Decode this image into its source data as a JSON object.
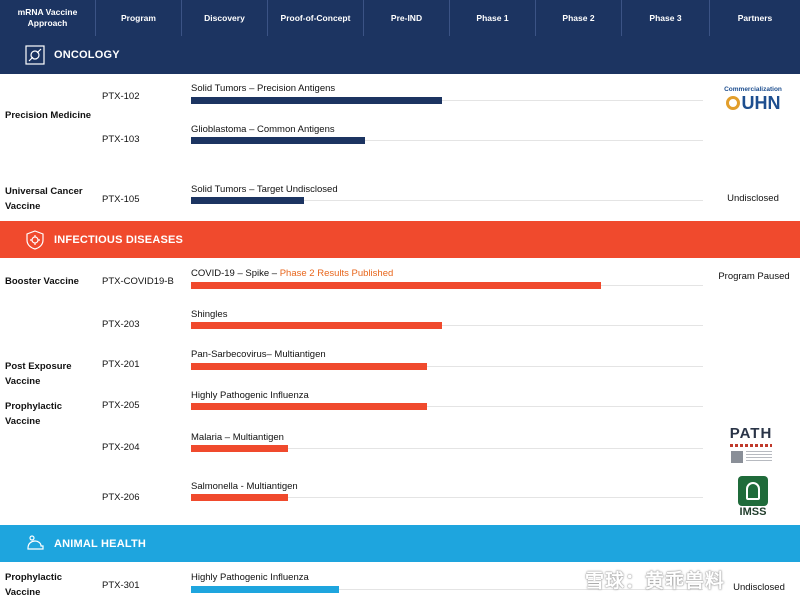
{
  "columns": {
    "approach": "mRNA Vaccine Approach",
    "program": "Program",
    "discovery": "Discovery",
    "poc": "Proof-of-Concept",
    "preind": "Pre-IND",
    "phase1": "Phase 1",
    "phase2": "Phase 2",
    "phase3": "Phase 3",
    "partners": "Partners"
  },
  "sections": {
    "oncology": {
      "label": "ONCOLOGY",
      "color": "#1c3461",
      "icon": "oncology-icon"
    },
    "infectious": {
      "label": "INFECTIOUS DISEASES",
      "color": "#f04a2d",
      "icon": "virus-shield-icon"
    },
    "animal": {
      "label": "ANIMAL HEALTH",
      "color": "#1ea5de",
      "icon": "animal-icon"
    }
  },
  "categories": {
    "precision_medicine": "Precision Medicine",
    "universal_cancer": "Universal Cancer Vaccine",
    "booster": "Booster Vaccine",
    "post_exposure": "Post Exposure Vaccine",
    "prophylactic": "Prophylactic Vaccine",
    "prophylactic_animal": "Prophylactic Vaccine"
  },
  "programs": [
    {
      "id": "PTX-102",
      "title": "Solid Tumors – Precision Antigens",
      "progress": 0.49,
      "color": "#1c3461"
    },
    {
      "id": "PTX-103",
      "title": "Glioblastoma – Common Antigens",
      "progress": 0.34,
      "color": "#1c3461"
    },
    {
      "id": "PTX-105",
      "title": "Solid Tumors – Target Undisclosed",
      "progress": 0.22,
      "color": "#1c3461"
    },
    {
      "id": "PTX-COVID19-B",
      "title": "COVID-19 – Spike – ",
      "highlight": "Phase 2 Results Published",
      "progress": 0.8,
      "color": "#f04a2d"
    },
    {
      "id": "PTX-203",
      "title": "Shingles",
      "progress": 0.49,
      "color": "#f04a2d"
    },
    {
      "id": "PTX-201",
      "title": "Pan-Sarbecovirus– Multiantigen",
      "progress": 0.46,
      "color": "#f04a2d"
    },
    {
      "id": "PTX-205",
      "title": "Highly Pathogenic Influenza",
      "progress": 0.46,
      "color": "#f04a2d"
    },
    {
      "id": "PTX-204",
      "title": "Malaria – Multiantigen",
      "progress": 0.19,
      "color": "#f04a2d"
    },
    {
      "id": "PTX-206",
      "title": "Salmonella - Multiantigen",
      "progress": 0.19,
      "color": "#f04a2d"
    },
    {
      "id": "PTX-301",
      "title": "Highly Pathogenic Influenza",
      "progress": 0.29,
      "color": "#1ea5de"
    }
  ],
  "partners": {
    "uhn_small": "Commercialization",
    "uhn": "UHN",
    "undisclosed": "Undisclosed",
    "paused": "Program Paused",
    "path": "PATH",
    "imss": "IMSS",
    "undisclosed_animal": "Undisclosed"
  },
  "watermark": "雪球：黄乖兽料"
}
